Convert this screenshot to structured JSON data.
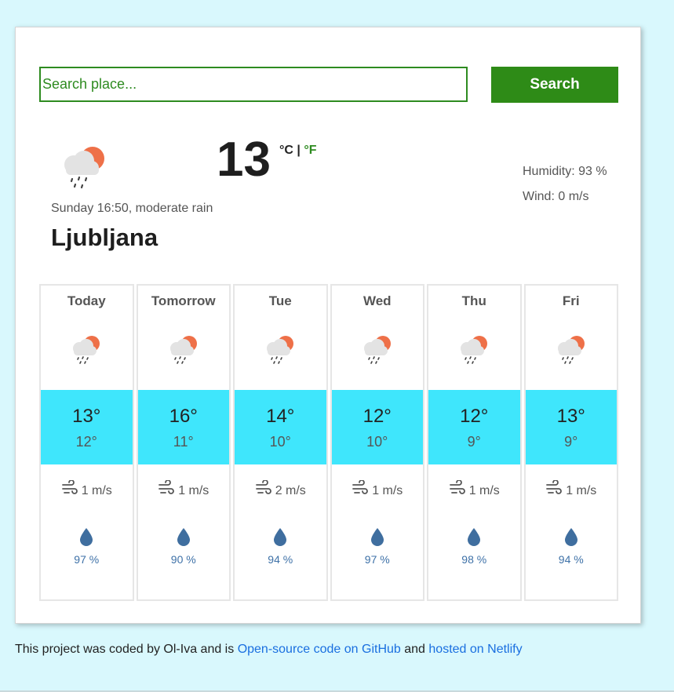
{
  "search": {
    "placeholder": "Search place...",
    "button_label": "Search"
  },
  "current": {
    "icon": "rain-cloud-sun-icon",
    "temperature": "13",
    "unit_celsius": "°C",
    "unit_separator": "|",
    "unit_fahrenheit": "°F",
    "date_description": "Sunday 16:50, moderate rain",
    "city": "Ljubljana",
    "humidity": "Humidity: 93 %",
    "wind": "Wind: 0 m/s"
  },
  "forecast": [
    {
      "day": "Today",
      "max": "13°",
      "min": "12°",
      "wind": "1 m/s",
      "rain": "97 %"
    },
    {
      "day": "Tomorrow",
      "max": "16°",
      "min": "11°",
      "wind": "1 m/s",
      "rain": "90 %"
    },
    {
      "day": "Tue",
      "max": "14°",
      "min": "10°",
      "wind": "2 m/s",
      "rain": "94 %"
    },
    {
      "day": "Wed",
      "max": "12°",
      "min": "10°",
      "wind": "1 m/s",
      "rain": "97 %"
    },
    {
      "day": "Thu",
      "max": "12°",
      "min": "9°",
      "wind": "1 m/s",
      "rain": "98 %"
    },
    {
      "day": "Fri",
      "max": "13°",
      "min": "9°",
      "wind": "1 m/s",
      "rain": "94 %"
    }
  ],
  "footer": {
    "text_before": "This project was coded by Ol-Iva and is ",
    "github_link": "Open-source code on GitHub",
    "text_middle": " and ",
    "netlify_link": "hosted on Netlify"
  },
  "colors": {
    "accent_green": "#2e8b17",
    "temp_band": "#3fe6fc",
    "page_background": "#d9f8fd",
    "link_blue": "#1a6fe0",
    "drop_blue": "#3f72a8"
  }
}
